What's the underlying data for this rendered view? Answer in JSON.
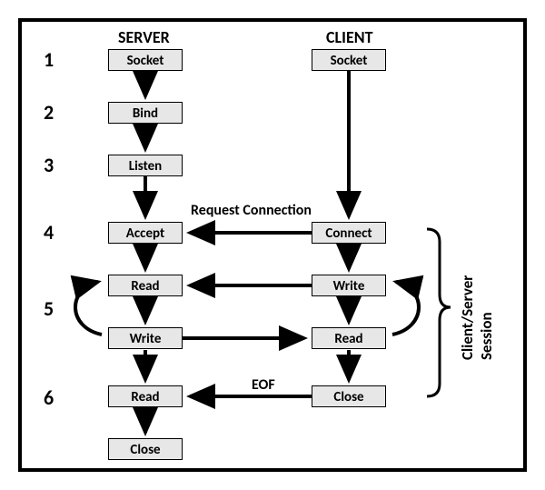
{
  "headers": {
    "server": "SERVER",
    "client": "CLIENT"
  },
  "steps": {
    "s1": "1",
    "s2": "2",
    "s3": "3",
    "s4": "4",
    "s5": "5",
    "s6": "6"
  },
  "server": {
    "socket": "Socket",
    "bind": "Bind",
    "listen": "Listen",
    "accept": "Accept",
    "read1": "Read",
    "write": "Write",
    "read2": "Read",
    "close": "Close"
  },
  "client": {
    "socket": "Socket",
    "connect": "Connect",
    "write": "Write",
    "read": "Read",
    "close": "Close"
  },
  "labels": {
    "req": "Request Connection",
    "eof": "EOF",
    "session": "Client/Server Session"
  }
}
